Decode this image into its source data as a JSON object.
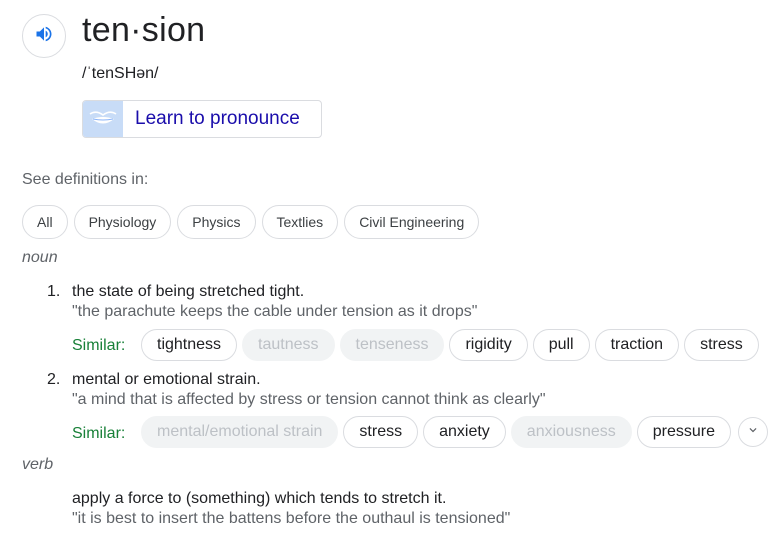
{
  "header": {
    "word": "ten·sion",
    "phonetic": "/ˈtenSHən/",
    "learn_label": "Learn to pronounce",
    "speaker_icon": "speaker-icon",
    "learn_icon": "mouth-icon"
  },
  "see_defs_label": "See definitions in:",
  "categories": [
    "All",
    "Physiology",
    "Physics",
    "Textlies",
    "Civil Engineering"
  ],
  "noun": {
    "pos": "noun",
    "senses": [
      {
        "num": "1.",
        "definition": "the state of being stretched tight.",
        "example": "\"the parachute keeps the cable under tension as it drops\"",
        "similar_label": "Similar:",
        "similar": [
          {
            "word": "tightness",
            "muted": false
          },
          {
            "word": "tautness",
            "muted": true
          },
          {
            "word": "tenseness",
            "muted": true
          },
          {
            "word": "rigidity",
            "muted": false
          },
          {
            "word": "pull",
            "muted": false
          },
          {
            "word": "traction",
            "muted": false
          },
          {
            "word": "stress",
            "muted": false
          }
        ]
      },
      {
        "num": "2.",
        "definition": "mental or emotional strain.",
        "example": "\"a mind that is affected by stress or tension cannot think as clearly\"",
        "similar_label": "Similar:",
        "similar": [
          {
            "word": "mental/emotional strain",
            "muted": true
          },
          {
            "word": "stress",
            "muted": false
          },
          {
            "word": "anxiety",
            "muted": false
          },
          {
            "word": "anxiousness",
            "muted": true
          },
          {
            "word": "pressure",
            "muted": false
          }
        ]
      }
    ]
  },
  "verb": {
    "pos": "verb",
    "definition": "apply a force to (something) which tends to stretch it.",
    "example": "\"it is best to insert the battens before the outhaul is tensioned\""
  },
  "colors": {
    "link": "#1a0dab",
    "similar": "#188038",
    "muted_chip_bg": "#f1f3f4",
    "muted_chip_text": "#bdc1c6"
  }
}
